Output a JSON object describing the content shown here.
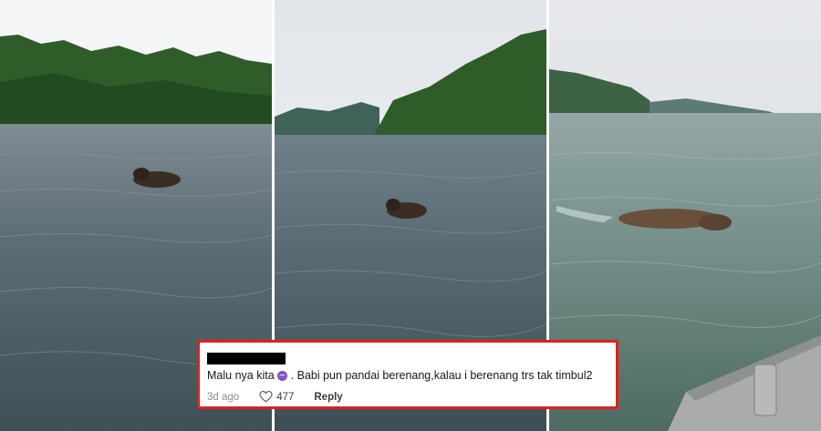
{
  "panels": [
    {
      "name": "boar-swimming-far"
    },
    {
      "name": "boar-swimming-mid"
    },
    {
      "name": "boar-swimming-near-boat"
    }
  ],
  "comment": {
    "text_before_emoji": "Malu nya kita",
    "emoji": "smiling-emoji",
    "text_after_emoji": ". Babi pun pandai berenang,kalau i berenang trs tak timbul2",
    "age": "3d ago",
    "likes": "477",
    "reply_label": "Reply"
  },
  "colors": {
    "highlight_border": "#e0201c",
    "water": "#55676d",
    "forest": "#2c5a28"
  }
}
